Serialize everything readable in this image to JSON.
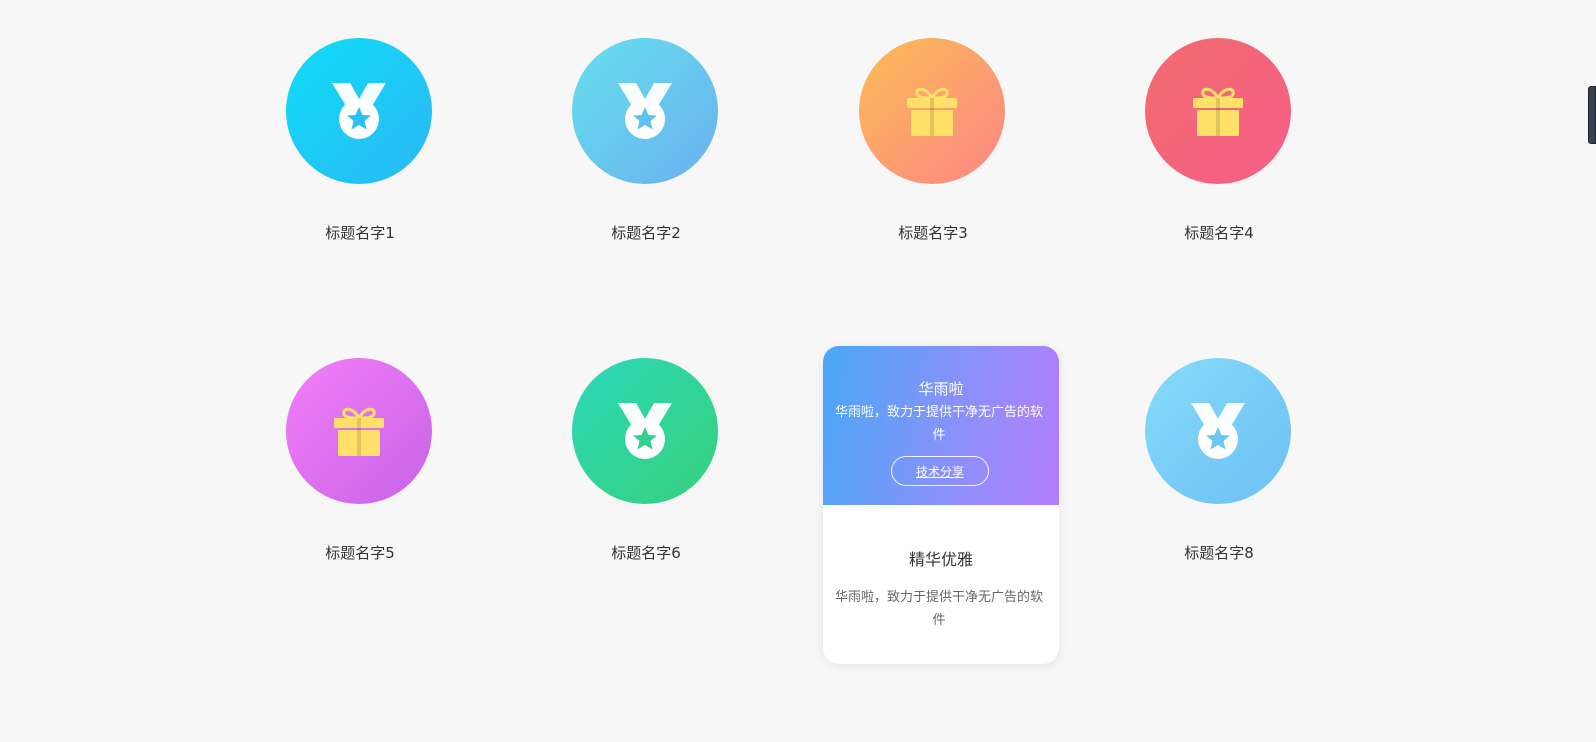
{
  "cards": [
    {
      "title": "标题名字1",
      "icon": "medal-icon",
      "gradient": [
        "#0fdcf6",
        "#2bb8f6"
      ],
      "icon_color": "#2bc0f6"
    },
    {
      "title": "标题名字2",
      "icon": "medal-icon",
      "gradient": [
        "#66e0ec",
        "#6ab0f0"
      ],
      "icon_color": "#5ec4ef"
    },
    {
      "title": "标题名字3",
      "icon": "gift-icon",
      "gradient": [
        "#fbbd55",
        "#fc8585"
      ],
      "icon_color": "#ffe16a"
    },
    {
      "title": "标题名字4",
      "icon": "gift-icon",
      "gradient": [
        "#f46b6f",
        "#f55e88"
      ],
      "icon_color": "#ffe16a"
    },
    {
      "title": "标题名字5",
      "icon": "gift-icon",
      "gradient": [
        "#f47ef8",
        "#c763e6"
      ],
      "icon_color": "#ffe16a"
    },
    {
      "title": "标题名字6",
      "icon": "medal-icon",
      "gradient": [
        "#2ed8ba",
        "#36d07a"
      ],
      "icon_color": "#35cf90"
    },
    {
      "title": "标题名字8",
      "icon": "medal-icon",
      "gradient": [
        "#86dcf8",
        "#6cbff5"
      ],
      "icon_color": "#6cc6f4"
    }
  ],
  "active_card": {
    "banner_title": "华雨啦",
    "banner_desc": "华雨啦，致力于提供干净无广告的软件",
    "button_label": "技术分享",
    "title": "精华优雅",
    "desc": "华雨啦，致力于提供干净无广告的软件"
  }
}
